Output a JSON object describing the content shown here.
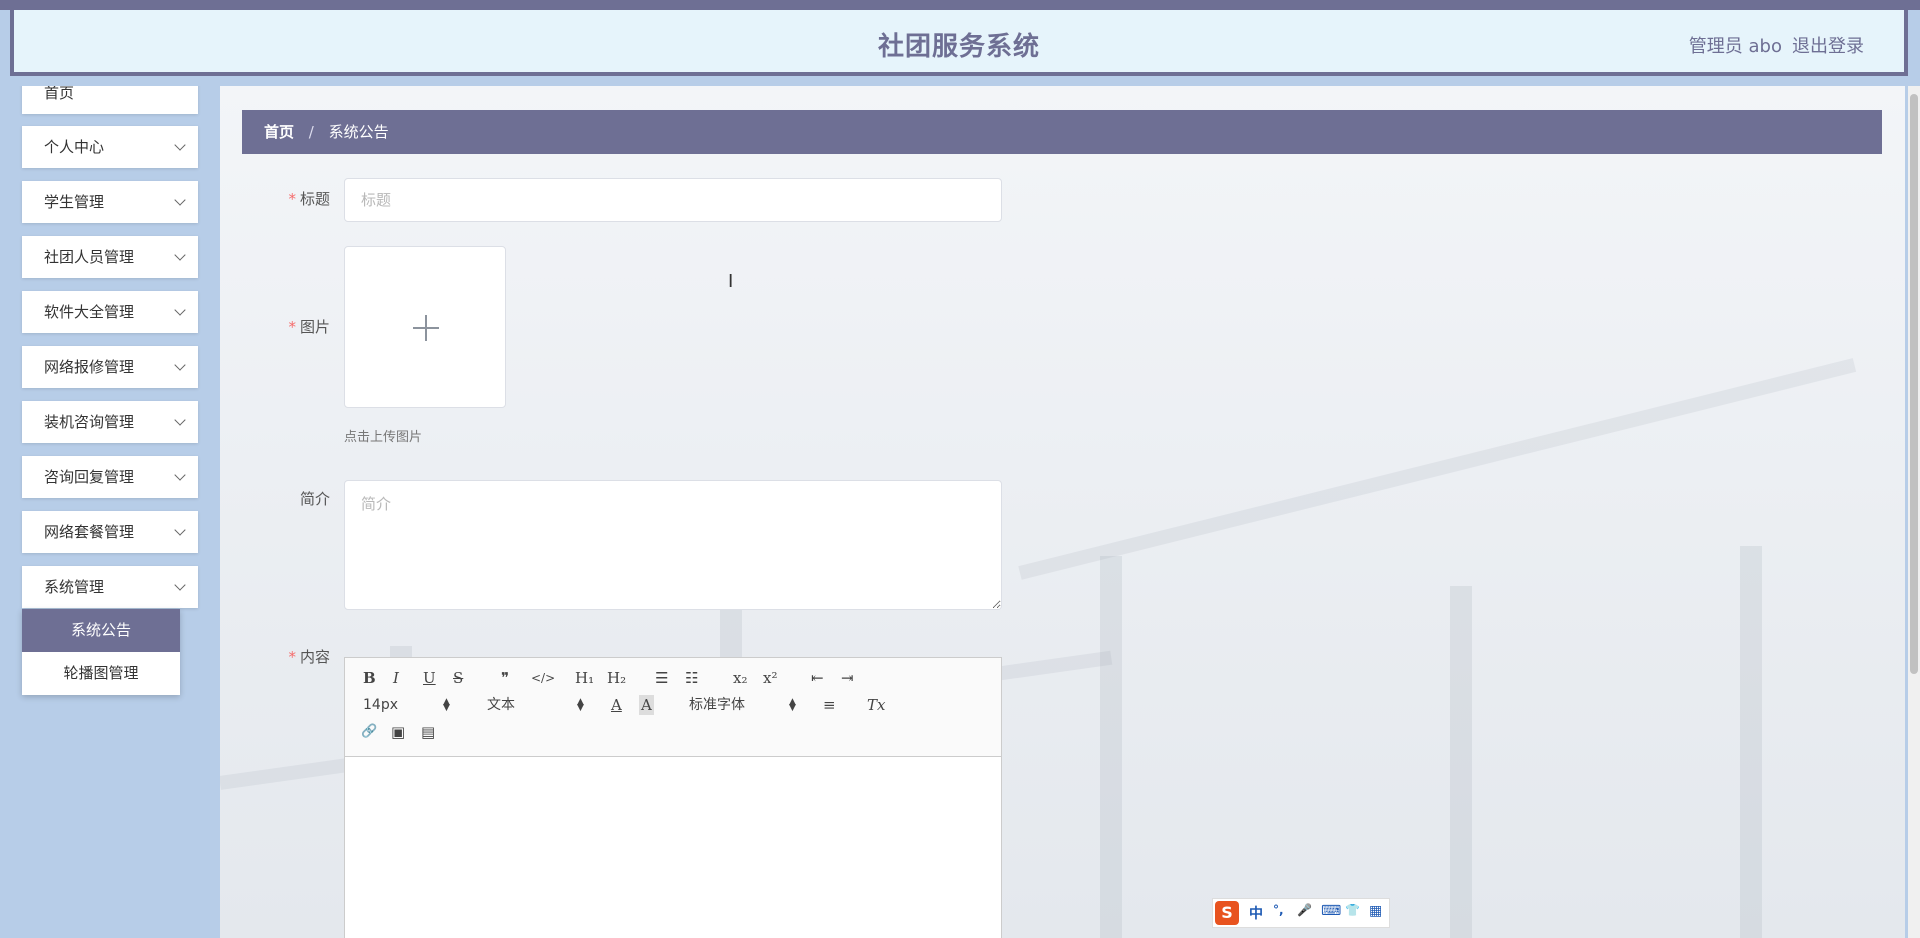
{
  "app": {
    "title": "社团服务系统",
    "user": "管理员 abo",
    "logout": "退出登录"
  },
  "sidebar": {
    "items": [
      {
        "label": "首页"
      },
      {
        "label": "个人中心"
      },
      {
        "label": "学生管理"
      },
      {
        "label": "社团人员管理"
      },
      {
        "label": "软件大全管理"
      },
      {
        "label": "网络报修管理"
      },
      {
        "label": "装机咨询管理"
      },
      {
        "label": "咨询回复管理"
      },
      {
        "label": "网络套餐管理"
      },
      {
        "label": "系统管理"
      }
    ],
    "submenu": [
      {
        "label": "系统公告",
        "active": true
      },
      {
        "label": "轮播图管理"
      }
    ]
  },
  "breadcrumb": {
    "home": "首页",
    "separator": "/",
    "current": "系统公告"
  },
  "form": {
    "title_label": "标题",
    "title_placeholder": "标题",
    "image_label": "图片",
    "upload_tip": "点击上传图片",
    "intro_label": "简介",
    "intro_placeholder": "简介",
    "content_label": "内容",
    "required_mark": "*"
  },
  "editor": {
    "font_size": "14px",
    "paragraph": "文本",
    "font_family": "标准字体",
    "buttons": {
      "bold": "B",
      "italic": "I",
      "underline": "U",
      "strike": "S",
      "quote": "❞",
      "code": "</>",
      "h1": "H₁",
      "h2": "H₂",
      "ordered_list": "☰",
      "bullet_list": "☷",
      "subscript": "x₂",
      "superscript": "x²",
      "outdent": "⇤",
      "indent": "⇥",
      "color": "A",
      "background": "A",
      "align": "≡",
      "clean": "Tx",
      "link": "🔗",
      "image": "▣",
      "video": "▤"
    }
  },
  "ime": {
    "logo": "S",
    "lang": "中",
    "punct": "°,",
    "mic": "🎤",
    "keyboard": "⌨",
    "skin": "👕",
    "apps": "▦"
  },
  "colors": {
    "primary": "#6e6f94",
    "sidebar_bg": "#b7cde8",
    "header_bg": "#e6f4fb",
    "required": "#f56c6c"
  }
}
